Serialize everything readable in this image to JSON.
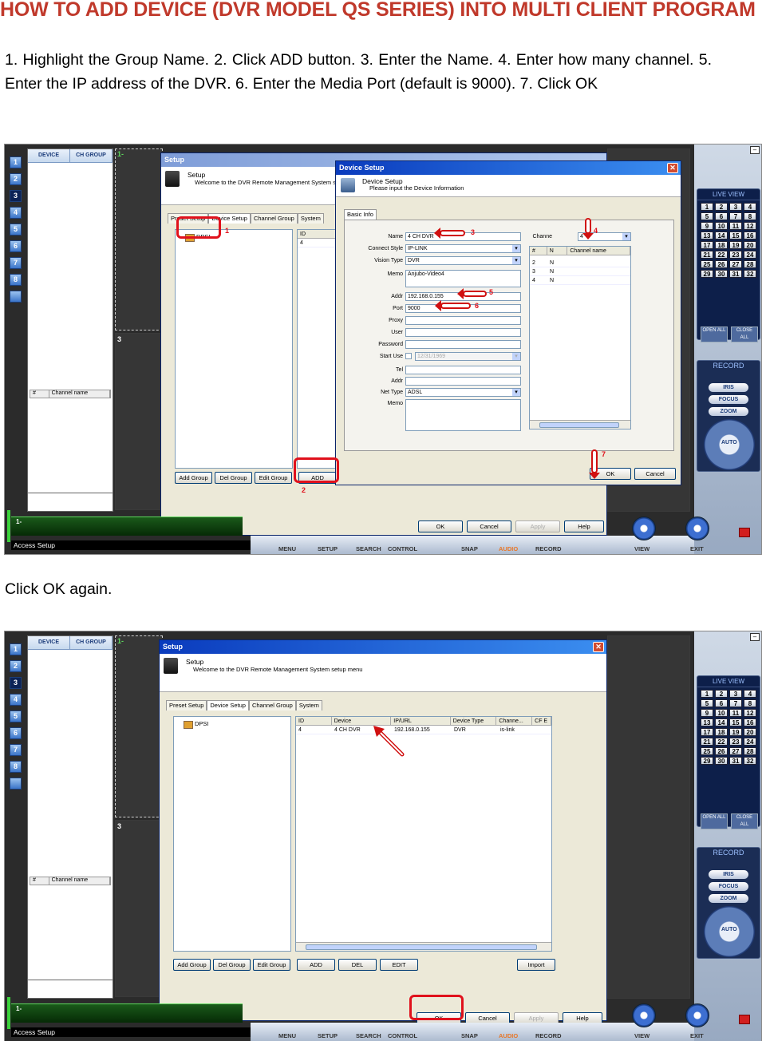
{
  "doc": {
    "title": "HOW TO ADD DEVICE (DVR MODEL QS SERIES)  INTO MULTI CLIENT PROGRAM",
    "instructions": "1. Highlight the Group Name. 2. Click ADD button. 3. Enter the Name. 4. Enter how many channel. 5. Enter the IP address of the DVR. 6. Enter the Media Port (default is 9000). 7. Click OK",
    "caption2": "Click OK again."
  },
  "app": {
    "device_tab": "DEVICE",
    "chgroup_tab": "CH GROUP",
    "left_buttons": [
      "1",
      "2",
      "3",
      "4",
      "5",
      "6",
      "7",
      "8",
      ""
    ],
    "tile_1": "1-",
    "tile_3": "3",
    "channel_hdr_num": "#",
    "channel_hdr_name": "Channel name",
    "greenbar_text": "1-",
    "access_text": "Access Setup",
    "menu": [
      "MENU",
      "SETUP",
      "SEARCH",
      "CONTROL",
      "SNAP",
      "AUDIO",
      "RECORD"
    ],
    "view": "VIEW",
    "exit": "EXIT",
    "live_view": "LIVE VIEW",
    "live_numbers": [
      "1",
      "2",
      "3",
      "4",
      "5",
      "6",
      "7",
      "8",
      "9",
      "10",
      "11",
      "12",
      "13",
      "14",
      "15",
      "16",
      "17",
      "18",
      "19",
      "20",
      "21",
      "22",
      "23",
      "24",
      "25",
      "26",
      "27",
      "28",
      "29",
      "30",
      "31",
      "32"
    ],
    "open_all": "OPEN ALL",
    "close_all": "CLOSE ALL",
    "record": "RECORD",
    "iris": "IRIS",
    "focus": "FOCUS",
    "zoom": "ZOOM",
    "auto": "AUTO"
  },
  "setup": {
    "title": "Setup",
    "heading": "Setup",
    "subheading": "Welcome to the DVR Remote Management System setup menu",
    "tabs": [
      "Preset Setup",
      "Device Setup",
      "Channel Group",
      "System"
    ],
    "group": "DPSI",
    "list_headers": [
      "ID",
      "Device",
      "IP/URL",
      "Device Type",
      "Channe...",
      "CF E"
    ],
    "row": [
      "4",
      "4 CH DVR",
      "192.168.0.155",
      "DVR",
      "is-link"
    ],
    "buttons": {
      "add_group": "Add Group",
      "del_group": "Del Group",
      "edit_group": "Edit Group",
      "add": "ADD",
      "del": "DEL",
      "edit": "EDIT",
      "import": "Import",
      "ok": "OK",
      "cancel": "Cancel",
      "apply": "Apply",
      "help": "Help"
    }
  },
  "device_setup": {
    "title": "Device Setup",
    "heading": "Device Setup",
    "subheading": "Please input the Device Information",
    "tab": "Basic Info",
    "labels": [
      "Name",
      "Connect Style",
      "Vision Type",
      "Memo",
      "Addr",
      "Port",
      "Proxy",
      "User",
      "Password",
      "Start Use",
      "Tel",
      "Addr",
      "Net Type",
      "Memo"
    ],
    "name": "4 CH DVR",
    "connect_style": "IP-LINK",
    "vision_type": "DVR",
    "memo": "Anjubo-Video4",
    "addr": "192.168.0.155",
    "port": "9000",
    "start_use_date": "12/31/1969",
    "net_type": "ADSL",
    "channel_label": "Channe",
    "channel": "4",
    "ch_headers": [
      "#",
      "N",
      "Channel name"
    ],
    "ch_rows": [
      [
        "2",
        "N"
      ],
      [
        "3",
        "N"
      ],
      [
        "4",
        "N"
      ]
    ],
    "ok": "OK",
    "cancel": "Cancel"
  },
  "annotations": [
    "1",
    "2",
    "3",
    "4",
    "5",
    "6",
    "7"
  ]
}
